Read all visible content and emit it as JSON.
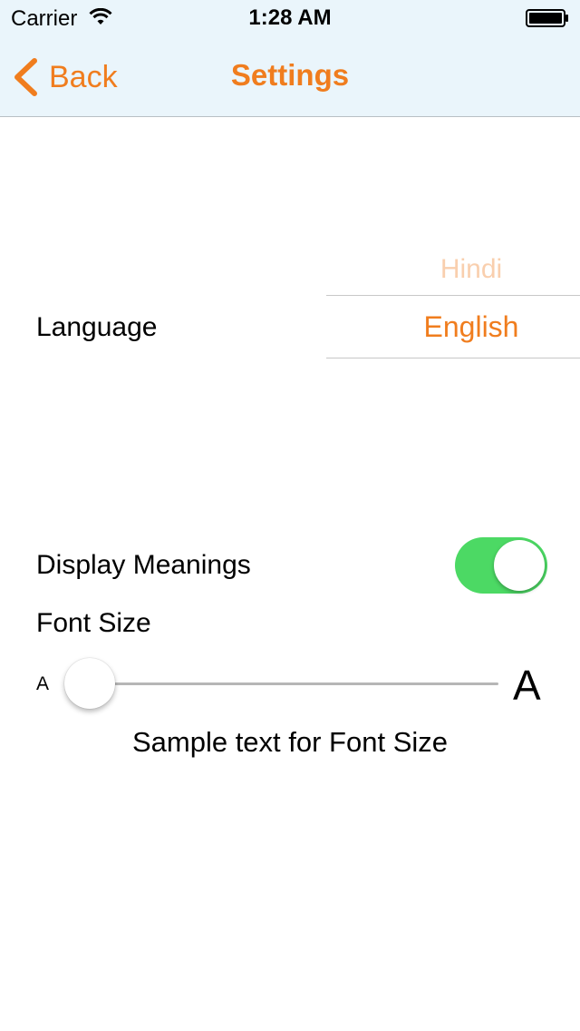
{
  "status_bar": {
    "carrier": "Carrier",
    "time": "1:28 AM",
    "wifi_icon": "wifi-icon",
    "battery_icon": "battery-full-icon"
  },
  "nav": {
    "back_label": "Back",
    "back_icon": "chevron-left-icon",
    "title": "Settings",
    "accent_color": "#f07d1e"
  },
  "language": {
    "label": "Language",
    "options": [
      "Hindi",
      "English"
    ],
    "selected": "English"
  },
  "display_meanings": {
    "label": "Display Meanings",
    "enabled": true,
    "on_color": "#4cd964"
  },
  "font_size": {
    "label": "Font Size",
    "min_label": "A",
    "max_label": "A",
    "value_fraction": 0.0,
    "sample_text": "Sample text for Font Size"
  }
}
